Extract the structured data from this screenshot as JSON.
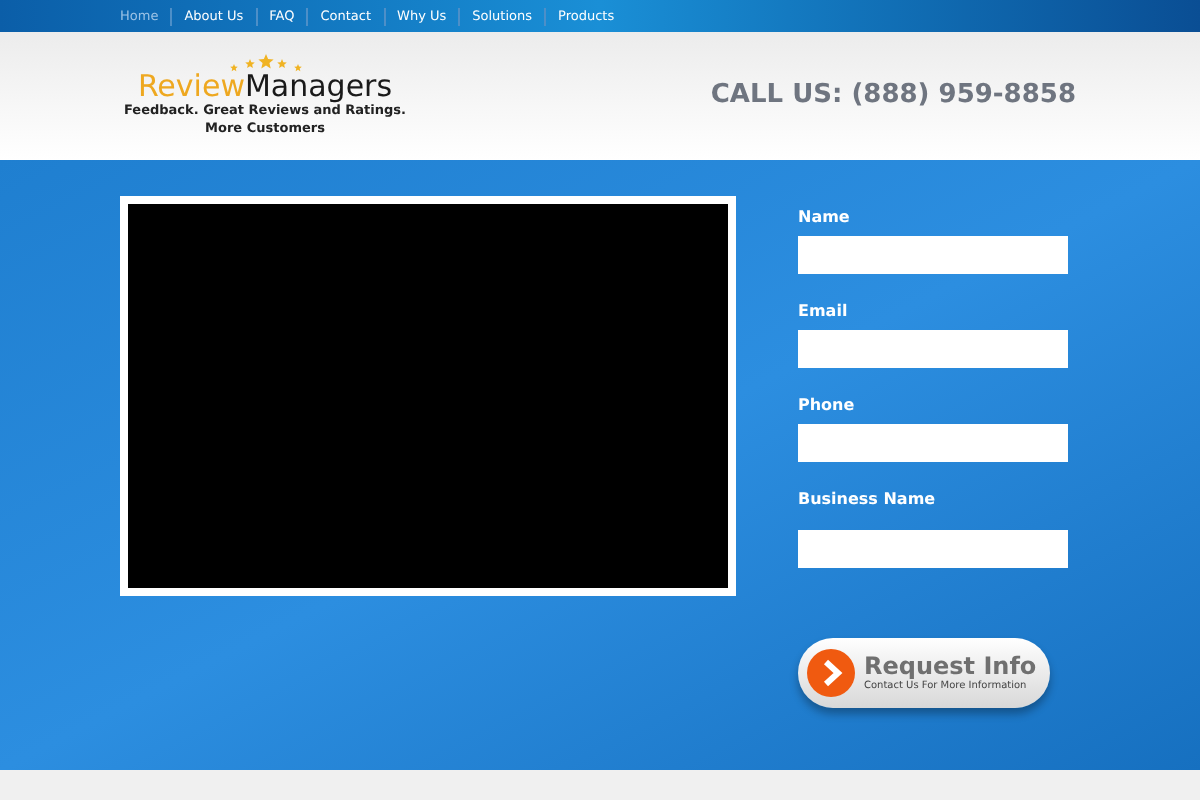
{
  "nav": [
    {
      "label": "Home",
      "selected": true
    },
    {
      "label": "About Us",
      "selected": false
    },
    {
      "label": "FAQ",
      "selected": false
    },
    {
      "label": "Contact",
      "selected": false
    },
    {
      "label": "Why Us",
      "selected": false
    },
    {
      "label": "Solutions",
      "selected": false
    },
    {
      "label": "Products",
      "selected": false
    }
  ],
  "logo": {
    "name_first": "Review",
    "name_second": "Managers",
    "tagline_1": "Feedback. Great Reviews and Ratings.",
    "tagline_2": "More Customers"
  },
  "call_us": "CALL US: (888) 959-8858",
  "form": {
    "fields": [
      {
        "label": "Name"
      },
      {
        "label": "Email"
      },
      {
        "label": "Phone"
      },
      {
        "label": "Business Name"
      }
    ],
    "button": {
      "title": "Request Info",
      "subtitle": "Contact Us For More Information"
    }
  }
}
